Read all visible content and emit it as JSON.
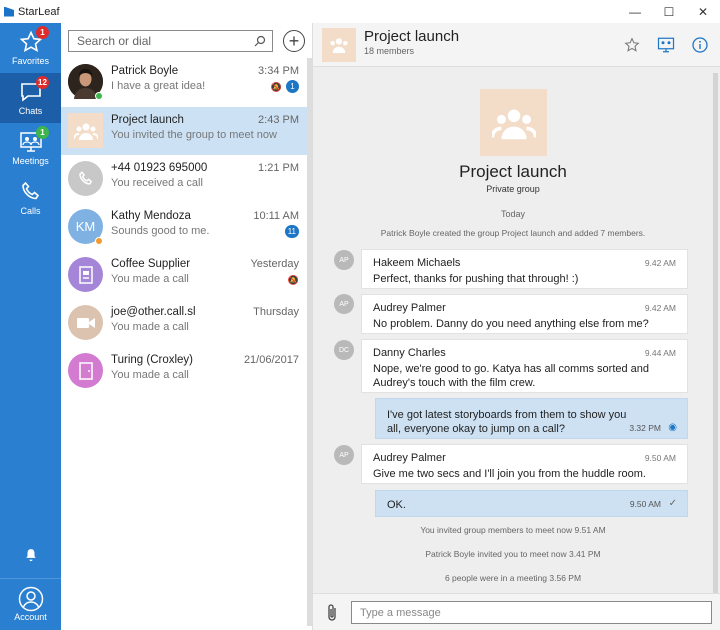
{
  "window": {
    "title": "StarLeaf",
    "controls": [
      "—",
      "☐",
      "✕"
    ]
  },
  "rail": {
    "items": [
      {
        "label": "Favorites",
        "badge": "1",
        "icon": "star-icon"
      },
      {
        "label": "Chats",
        "badge": "12",
        "icon": "chat-icon",
        "active": true
      },
      {
        "label": "Meetings",
        "badge": "1",
        "icon": "meetings-icon"
      },
      {
        "label": "Calls",
        "icon": "phone-icon"
      }
    ],
    "account_label": "Account"
  },
  "search": {
    "placeholder": "Search or dial"
  },
  "conversations": [
    {
      "name": "Patrick Boyle",
      "sub": "I have a great idea!",
      "time": "3:34 PM",
      "badge": "1",
      "muted": true
    },
    {
      "name": "Project launch",
      "sub": "You invited the group to meet now",
      "time": "2:43 PM",
      "selected": true
    },
    {
      "name": "+44 01923 695000",
      "sub": "You received a call",
      "time": "1:21 PM"
    },
    {
      "name": "Kathy Mendoza",
      "initials": "KM",
      "sub": "Sounds good to me.",
      "time": "10:11 AM",
      "badge": "11"
    },
    {
      "name": "Coffee Supplier",
      "sub": "You made a call",
      "time": "Yesterday",
      "muted": true
    },
    {
      "name": "joe@other.call.sl",
      "sub": "You made a call",
      "time": "Thursday"
    },
    {
      "name": "Turing (Croxley)",
      "sub": "You made a call",
      "time": "21/06/2017"
    }
  ],
  "chat": {
    "title": "Project launch",
    "members": "18 members",
    "group_name": "Project launch",
    "group_type": "Private group",
    "day": "Today",
    "created_msg": "Patrick Boyle created the group Project launch and added 7 members.",
    "messages": [
      {
        "initials": "AP",
        "sender": "Hakeem Michaels",
        "time": "9.42 AM",
        "text": "Perfect, thanks for pushing that through! :)"
      },
      {
        "initials": "AP",
        "sender": "Audrey Palmer",
        "time": "9.42 AM",
        "text": "No problem. Danny do you need anything else from me?"
      },
      {
        "initials": "DC",
        "sender": "Danny Charles",
        "time": "9.44 AM",
        "text": "Nope, we're good to go. Katya has all comms sorted and Audrey's touch with the film crew."
      },
      {
        "own": true,
        "text": "I've got latest storyboards from them to show you all, everyone okay to jump on a call?",
        "time": "3.32 PM"
      },
      {
        "initials": "AP",
        "sender": "Audrey Palmer",
        "time": "9.50 AM",
        "text": "Give me two secs and I'll join you from the huddle room."
      },
      {
        "own": true,
        "text": "OK.",
        "time": "9.50 AM"
      }
    ],
    "events": [
      "You invited group members to meet now   9.51 AM",
      "Patrick Boyle invited you to meet now   3.41 PM",
      "6 people were in a meeting   3.56 PM"
    ],
    "composer_placeholder": "Type a message"
  }
}
